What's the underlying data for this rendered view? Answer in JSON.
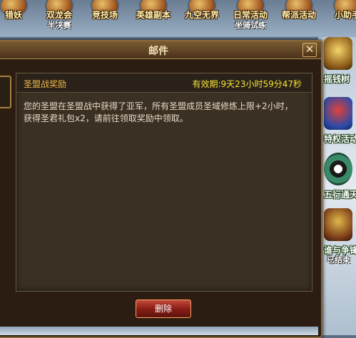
{
  "top_bar": {
    "items": [
      {
        "label": "猎妖",
        "sub": ""
      },
      {
        "label": "双龙会",
        "sub": "半决赛"
      },
      {
        "label": "竞技场",
        "sub": ""
      },
      {
        "label": "英雄副本",
        "sub": ""
      },
      {
        "label": "九空无界",
        "sub": ""
      },
      {
        "label": "日常活动",
        "sub": "坐骑试练"
      },
      {
        "label": "帮派活动",
        "sub": ""
      },
      {
        "label": "小助手",
        "sub": ""
      }
    ]
  },
  "right_bar": {
    "items": [
      {
        "label": "摇钱树",
        "sub": ""
      },
      {
        "label": "特权活动",
        "sub": ""
      },
      {
        "label": "五行通天",
        "sub": ""
      },
      {
        "label": "谁与争锋",
        "sub": "已结束"
      }
    ]
  },
  "mail_window": {
    "title": "邮件",
    "close_symbol": "✕",
    "subject": "圣盟战奖励",
    "validity": "有效期:9天23小时59分47秒",
    "body": "您的圣盟在圣盟战中获得了亚军，所有圣盟成员圣域修炼上限+2小时，获得圣君礼包x2，请前往领取奖励中领取。",
    "delete_label": "删除"
  },
  "colors": {
    "panel_bg": "#3a3024",
    "subject": "#f0b84a",
    "validity": "#f7e23a",
    "body_text": "#e8dcc6",
    "delete_button": "#8a1e16"
  }
}
